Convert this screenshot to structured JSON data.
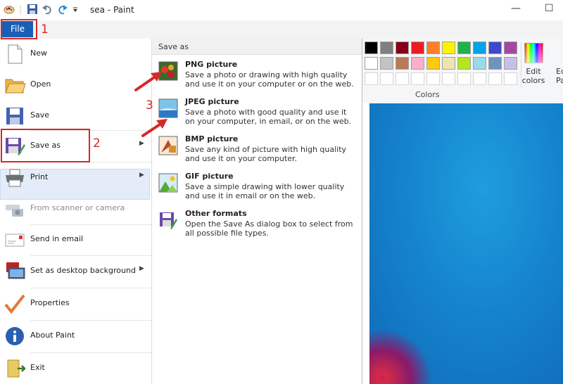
{
  "window": {
    "title": "sea - Paint",
    "minimize_glyph": "—",
    "maximize_glyph": "☐"
  },
  "quick_access": [
    "paint-app-icon",
    "save-icon",
    "undo-icon",
    "redo-icon",
    "customize-dropdown-icon"
  ],
  "file_tab": "File",
  "file_menu": {
    "items": [
      {
        "label": "New",
        "icon": "new-file-icon",
        "submenu": false,
        "disabled": false
      },
      {
        "label": "Open",
        "icon": "open-folder-icon",
        "submenu": false,
        "disabled": false
      },
      {
        "label": "Save",
        "icon": "save-disk-icon",
        "submenu": false,
        "disabled": false
      },
      {
        "label": "Save as",
        "icon": "save-as-icon",
        "submenu": true,
        "disabled": false
      },
      {
        "label": "Print",
        "icon": "printer-icon",
        "submenu": true,
        "disabled": false
      },
      {
        "label": "From scanner or camera",
        "icon": "scanner-icon",
        "submenu": false,
        "disabled": true
      },
      {
        "label": "Send in email",
        "icon": "email-icon",
        "submenu": false,
        "disabled": false
      },
      {
        "label": "Set as desktop background",
        "icon": "desktop-background-icon",
        "submenu": true,
        "disabled": false
      },
      {
        "label": "Properties",
        "icon": "checkmark-icon",
        "submenu": false,
        "disabled": false
      },
      {
        "label": "About Paint",
        "icon": "info-icon",
        "submenu": false,
        "disabled": false
      },
      {
        "label": "Exit",
        "icon": "exit-icon",
        "submenu": false,
        "disabled": false
      }
    ]
  },
  "save_as_panel": {
    "header": "Save as",
    "options": [
      {
        "title": "PNG picture",
        "desc": "Save a photo or drawing with high quality and use it on your computer or on the web.",
        "icon": "png-picture-icon"
      },
      {
        "title": "JPEG picture",
        "desc": "Save a photo with good quality and use it on your computer, in email, or on the web.",
        "icon": "jpeg-picture-icon"
      },
      {
        "title": "BMP picture",
        "desc": "Save any kind of picture with high quality and use it on your computer.",
        "icon": "bmp-picture-icon"
      },
      {
        "title": "GIF picture",
        "desc": "Save a simple drawing with lower quality and use it in email or on the web.",
        "icon": "gif-picture-icon"
      },
      {
        "title": "Other formats",
        "desc": "Open the Save As dialog box to select from all possible file types.",
        "icon": "other-formats-icon"
      }
    ]
  },
  "ribbon": {
    "colors_label": "Colors",
    "edit_colors_label": "Edit colors",
    "edit_paint_label": "Ed Pa",
    "palette_row1": [
      "#000000",
      "#7f7f7f",
      "#880015",
      "#ed1c24",
      "#ff7f27",
      "#fff200",
      "#22b14c",
      "#00a2e8",
      "#3f48cc",
      "#a349a4"
    ],
    "palette_row2": [
      "#ffffff",
      "#c3c3c3",
      "#b97a57",
      "#ffaec9",
      "#ffc90e",
      "#efe4b0",
      "#b5e61d",
      "#99d9ea",
      "#7092be",
      "#c8bfe7"
    ]
  },
  "annotations": {
    "step1": "1",
    "step2": "2",
    "step3": "3",
    "color": "#d62828"
  }
}
